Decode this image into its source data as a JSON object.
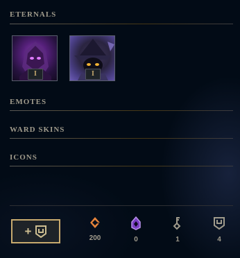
{
  "sections": {
    "eternals": "ETERNALS",
    "emotes": "EMOTES",
    "ward_skins": "WARD SKINS",
    "icons": "ICONS"
  },
  "eternals": [
    {
      "tier": "I",
      "icon": "malzahar-eternal-icon"
    },
    {
      "tier": "I",
      "icon": "veigar-eternal-icon"
    }
  ],
  "add_button": {
    "label": "+",
    "icon": "loot-shield-icon"
  },
  "currencies": [
    {
      "name": "orange-essence",
      "icon": "orange-essence-icon",
      "value": "200",
      "color": "#e6843b"
    },
    {
      "name": "mythic-essence",
      "icon": "mythic-essence-icon",
      "value": "0",
      "color": "#a26ad8"
    },
    {
      "name": "keys",
      "icon": "key-icon",
      "value": "1",
      "color": "#a09b8c"
    },
    {
      "name": "chests",
      "icon": "chest-shield-icon",
      "value": "4",
      "color": "#a09b8c"
    }
  ],
  "colors": {
    "gold": "#c8aa6e",
    "text": "#a09b8c",
    "background": "#010a13"
  }
}
